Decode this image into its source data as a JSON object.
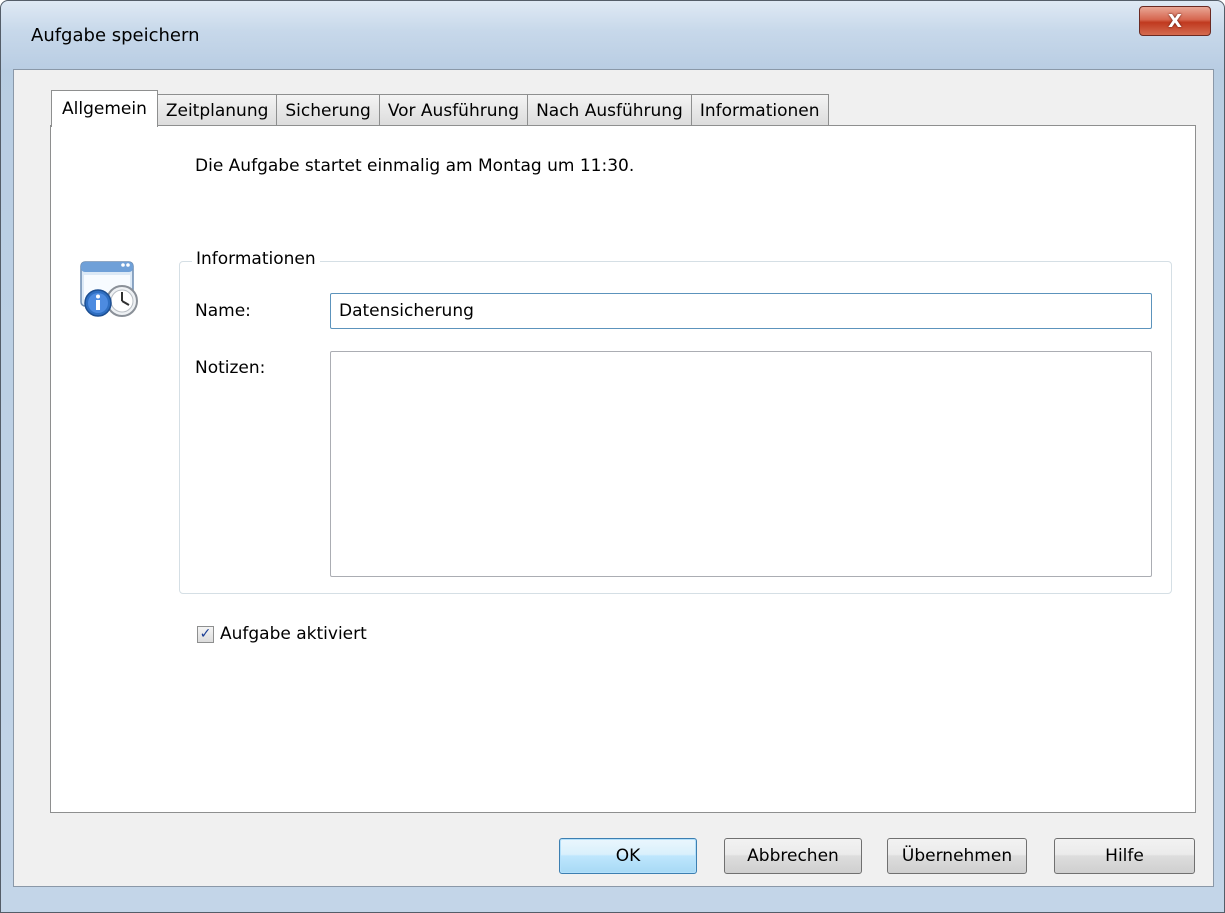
{
  "window": {
    "title": "Aufgabe speichern",
    "close_glyph": "X"
  },
  "tabs": [
    {
      "label": "Allgemein",
      "active": true
    },
    {
      "label": "Zeitplanung",
      "active": false
    },
    {
      "label": "Sicherung",
      "active": false
    },
    {
      "label": "Vor Ausführung",
      "active": false
    },
    {
      "label": "Nach Ausführung",
      "active": false
    },
    {
      "label": "Informationen",
      "active": false
    }
  ],
  "general": {
    "summary": "Die Aufgabe startet einmalig am Montag um 11:30.",
    "icon": "task-info-clock-icon",
    "group_title": "Informationen",
    "name_label": "Name:",
    "name_value": "Datensicherung",
    "notes_label": "Notizen:",
    "notes_value": "",
    "enabled_label": "Aufgabe aktiviert",
    "enabled_checked": true,
    "check_glyph": "✓"
  },
  "buttons": {
    "ok": "OK",
    "cancel": "Abbrechen",
    "apply": "Übernehmen",
    "help": "Hilfe"
  },
  "colors": {
    "accent": "#3c7fb1",
    "close": "#c0391f"
  }
}
